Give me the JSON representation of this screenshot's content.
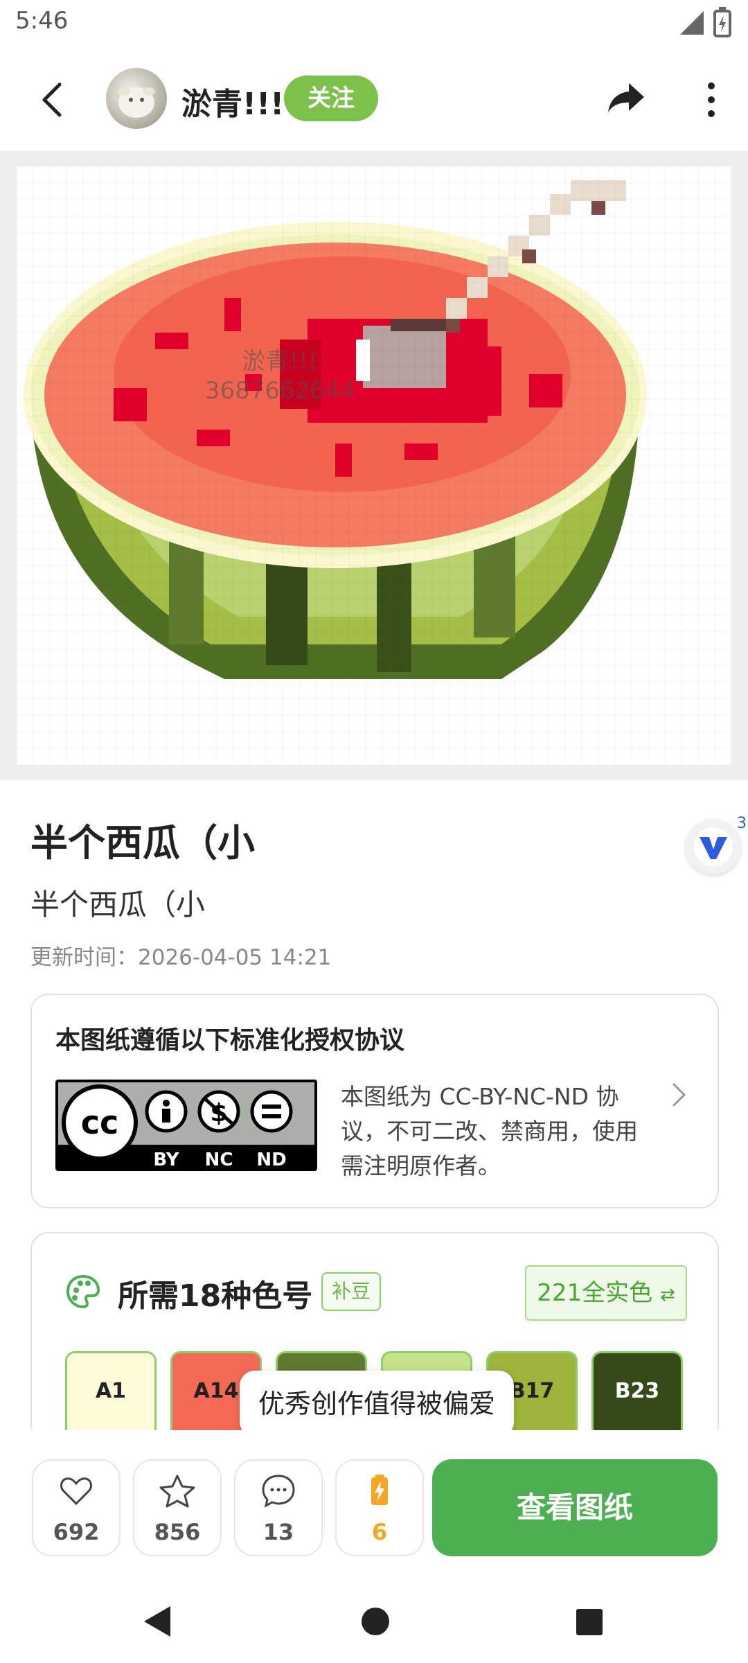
{
  "status_bar": {
    "time": "5:46"
  },
  "header": {
    "username": "淤青!!!",
    "follow_label": "关注"
  },
  "artwork": {
    "watermark_name": "淤青!!!",
    "watermark_id": "3687662644"
  },
  "design": {
    "title": "半个西瓜（小",
    "subtitle": "半个西瓜（小",
    "updated": "更新时间：2026-04-05 14:21",
    "v_badge_count": "3"
  },
  "license": {
    "title": "本图纸遵循以下标准化授权协议",
    "badge_labels": [
      "BY",
      "NC",
      "ND"
    ],
    "cc_mark": "cc",
    "description": "本图纸为 CC-BY-NC-ND 协议，不可二改、禁商用，使用需注明原作者。"
  },
  "colors": {
    "title": "所需18种色号",
    "tag": "补豆",
    "all_colors_label": "221全实色",
    "swatches": [
      {
        "code": "A1",
        "bg": "#fdfbd8",
        "fg": "#222222"
      },
      {
        "code": "A14",
        "bg": "#f36a55",
        "fg": "#222222"
      },
      {
        "code": "",
        "bg": "#5e7a2e",
        "fg": "#ffffff"
      },
      {
        "code": "",
        "bg": "#c4e38a",
        "fg": "#222222"
      },
      {
        "code": "B17",
        "bg": "#9db53c",
        "fg": "#222222"
      },
      {
        "code": "B23",
        "bg": "#354a18",
        "fg": "#ffffff"
      }
    ]
  },
  "toast": "优秀创作值得被偏爱",
  "actions": {
    "likes": "692",
    "favorites": "856",
    "comments": "13",
    "charge": "6",
    "view_label": "查看图纸"
  },
  "colors_theme": {
    "accent_green": "#4caf50",
    "follow_green": "#7cc24a",
    "charge_orange": "#f5a623"
  }
}
